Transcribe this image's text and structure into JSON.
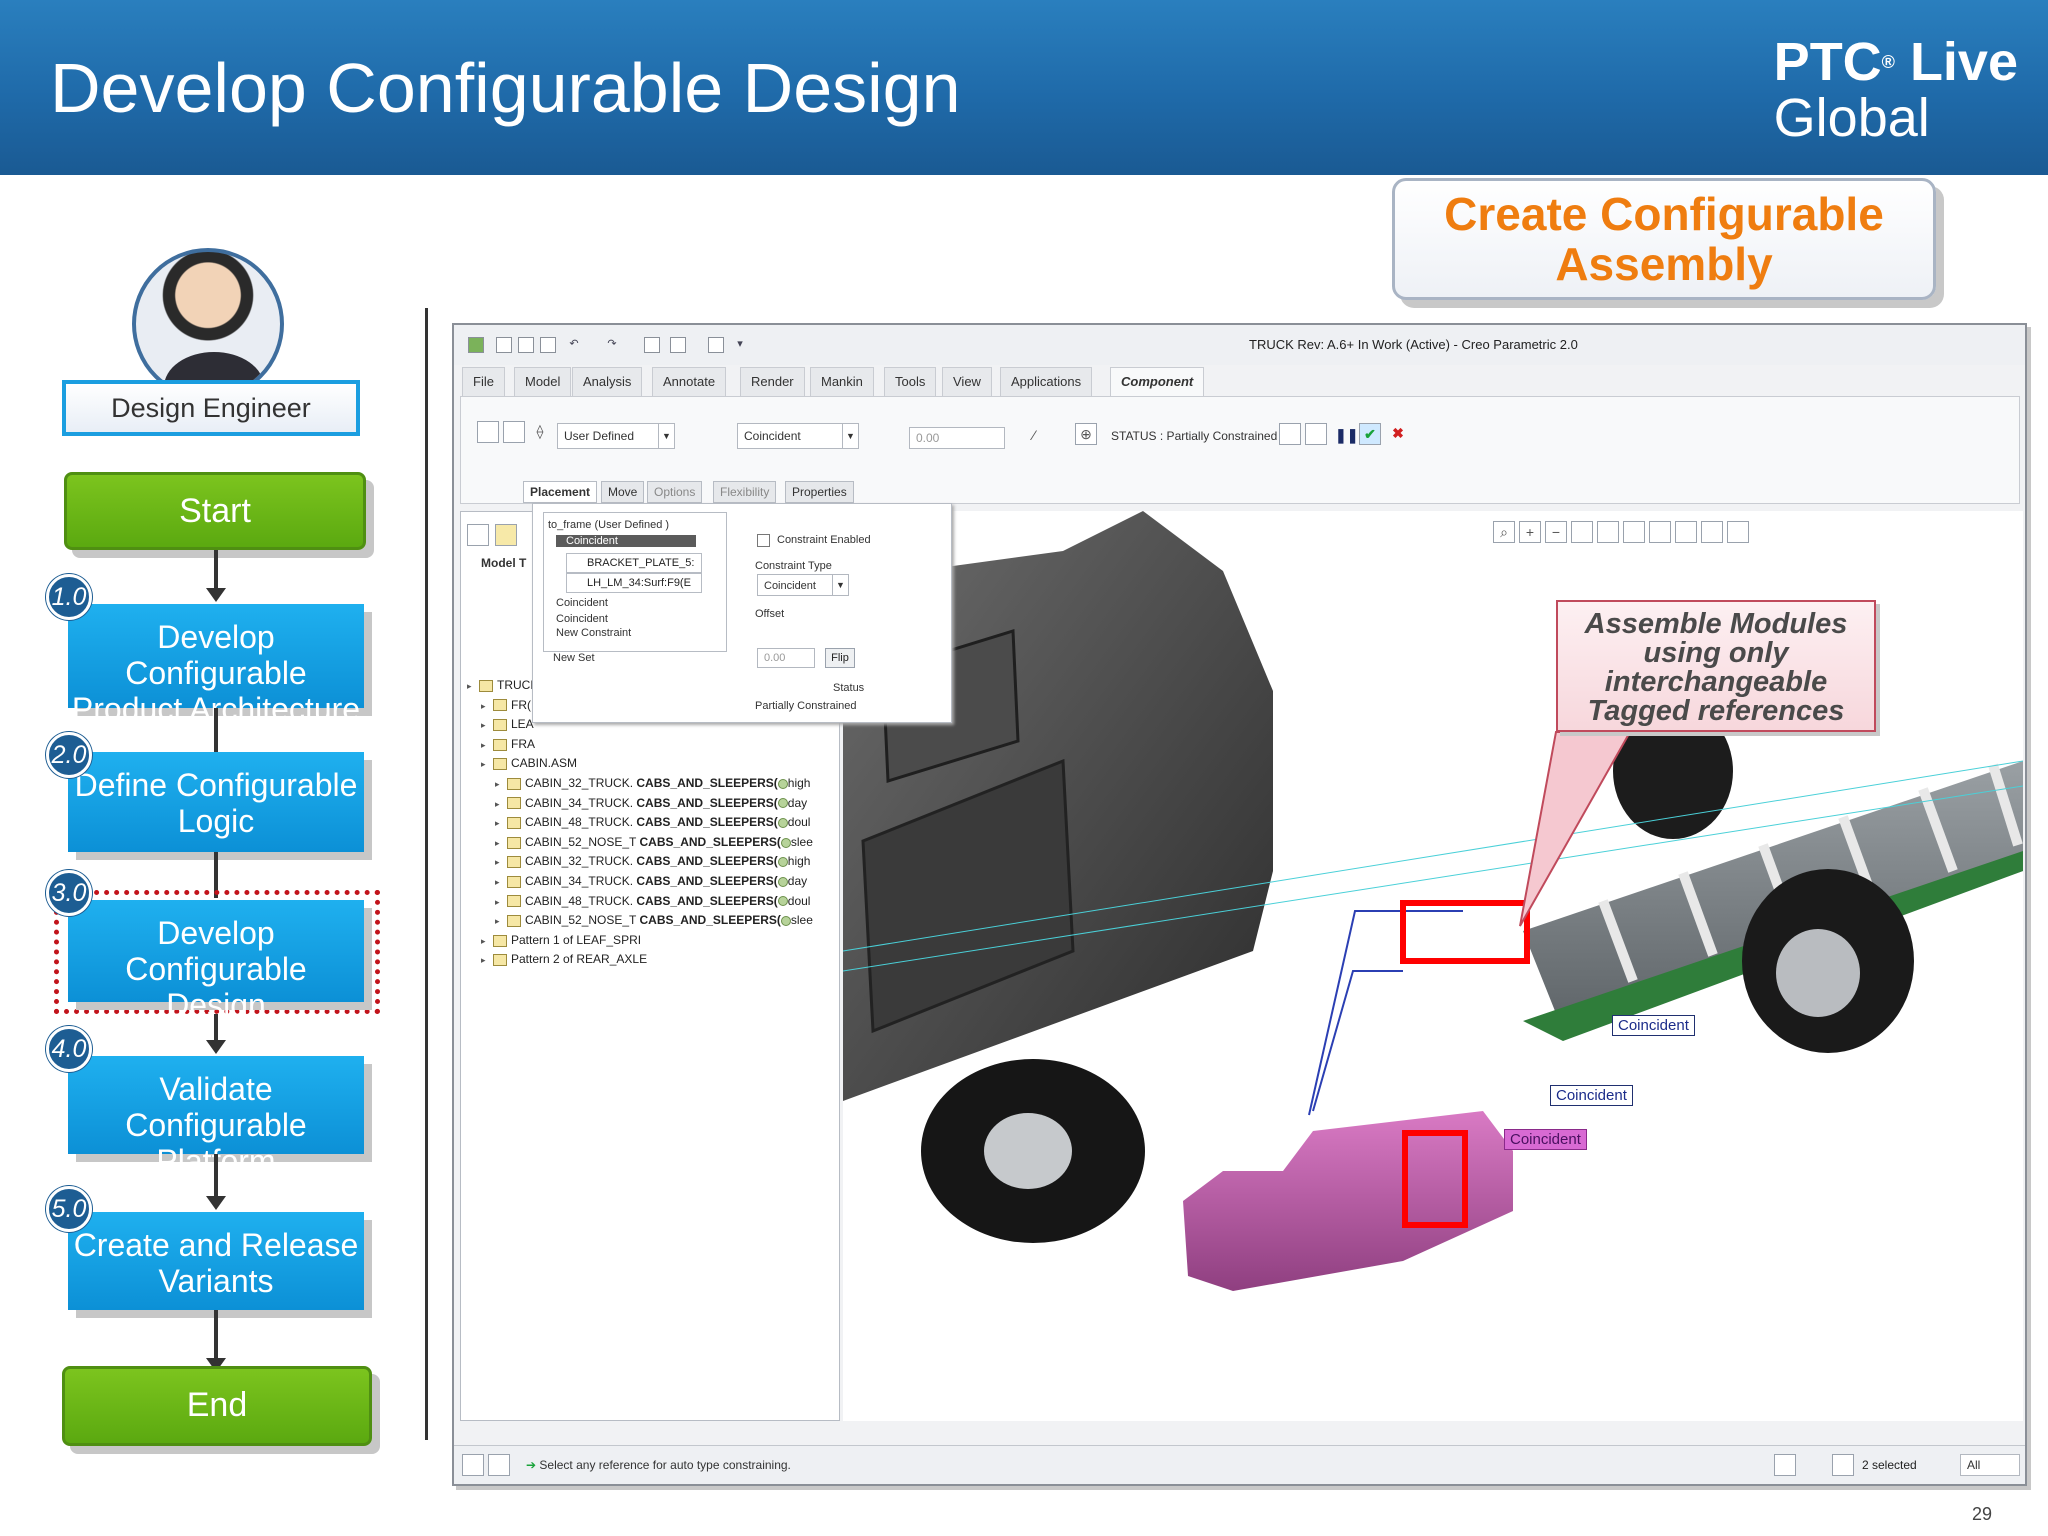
{
  "header": {
    "title": "Develop Configurable Design",
    "brand_line1": "PTC",
    "brand_reg": "®",
    "brand_live": " Live",
    "brand_line2": "Global"
  },
  "callout_main": {
    "line1": "Create Configurable",
    "line2": "Assembly"
  },
  "flow": {
    "role": "Design Engineer",
    "start": "Start",
    "end": "End",
    "steps": [
      {
        "num": "1.0",
        "line1": "Develop Configurable",
        "line2": "Product Architecture"
      },
      {
        "num": "2.0",
        "line1": "Define Configurable",
        "line2": "Logic"
      },
      {
        "num": "3.0",
        "line1": "Develop Configurable",
        "line2": "Design"
      },
      {
        "num": "4.0",
        "line1": "Validate Configurable",
        "line2": "Platform"
      },
      {
        "num": "5.0",
        "line1": "Create and Release",
        "line2": "Variants"
      }
    ],
    "selected_step": "3.0"
  },
  "creo": {
    "window_title": "TRUCK Rev: A.6+ In Work  (Active) - Creo Parametric 2.0",
    "tabs": [
      "File ▾",
      "Model",
      "Analysis",
      "Annotate",
      "Render",
      "Mankin",
      "Tools",
      "View",
      "Applications",
      "Component Placement"
    ],
    "active_tab": "Component Placement",
    "ribbon": {
      "constraint_set": "User Defined",
      "constraint_type": "Coincident",
      "offset_value": "0.00",
      "status": "STATUS : Partially Constrained"
    },
    "subtabs": [
      "Placement",
      "Move",
      "Options",
      "Flexibility",
      "Properties"
    ],
    "placement_panel": {
      "set_name": "to_frame (User Defined )",
      "selected": "Coincident",
      "ref1": "BRACKET_PLATE_5:",
      "ref2": "LH_LM_34:Surf:F9(E",
      "items": [
        "Coincident",
        "Coincident",
        "New Constraint"
      ],
      "new_set": "New Set",
      "constraint_enabled": "Constraint Enabled",
      "constraint_type_label": "Constraint Type",
      "constraint_type_value": "Coincident",
      "offset_label": "Offset",
      "offset_value": "0.00",
      "flip": "Flip",
      "status_label": "Status",
      "status_value": "Partially Constrained"
    },
    "model_tree": {
      "header": "Model T",
      "rows": [
        {
          "indent": 0,
          "text": "TRUCK",
          "bold": ""
        },
        {
          "indent": 1,
          "text": "FR(",
          "bold": ""
        },
        {
          "indent": 1,
          "text": "LEA",
          "bold": ""
        },
        {
          "indent": 1,
          "text": "FRA",
          "bold": ""
        },
        {
          "indent": 1,
          "text": "CABIN.ASM",
          "bold": ""
        },
        {
          "indent": 2,
          "text": "CABIN_32_TRUCK.",
          "bold": "CABS_AND_SLEEPERS(",
          "tail": "high"
        },
        {
          "indent": 2,
          "text": "CABIN_34_TRUCK.",
          "bold": "CABS_AND_SLEEPERS(",
          "tail": "day"
        },
        {
          "indent": 2,
          "text": "CABIN_48_TRUCK.",
          "bold": "CABS_AND_SLEEPERS(",
          "tail": "doul"
        },
        {
          "indent": 2,
          "text": "CABIN_52_NOSE_T",
          "bold": "CABS_AND_SLEEPERS(",
          "tail": "slee"
        },
        {
          "indent": 2,
          "text": "CABIN_32_TRUCK.",
          "bold": "CABS_AND_SLEEPERS(",
          "tail": "high"
        },
        {
          "indent": 2,
          "text": "CABIN_34_TRUCK.",
          "bold": "CABS_AND_SLEEPERS(",
          "tail": "day"
        },
        {
          "indent": 2,
          "text": "CABIN_48_TRUCK.",
          "bold": "CABS_AND_SLEEPERS(",
          "tail": "doul"
        },
        {
          "indent": 2,
          "text": "CABIN_52_NOSE_T",
          "bold": "CABS_AND_SLEEPERS(",
          "tail": "slee"
        },
        {
          "indent": 1,
          "text": "Pattern 1 of LEAF_SPRI",
          "bold": ""
        },
        {
          "indent": 1,
          "text": "Pattern 2 of REAR_AXLE",
          "bold": ""
        }
      ]
    },
    "status_bar": {
      "message": "Select any reference for auto type constraining.",
      "selected": "2 selected",
      "filter": "All"
    },
    "labels": {
      "coincident_1": "Coincident",
      "coincident_2": "Coincident",
      "coincident_3": "Coincident"
    }
  },
  "tagged_callout": {
    "line1": "Assemble Modules",
    "line2": "using only",
    "line3": "interchangeable",
    "line4": "Tagged references"
  },
  "page_number": "29",
  "colors": {
    "header_blue": "#1f6aa9",
    "step_blue": "#0c90d6",
    "start_green": "#5ba910",
    "callout_orange": "#ef7d10",
    "highlight_red": "#ff0000"
  }
}
